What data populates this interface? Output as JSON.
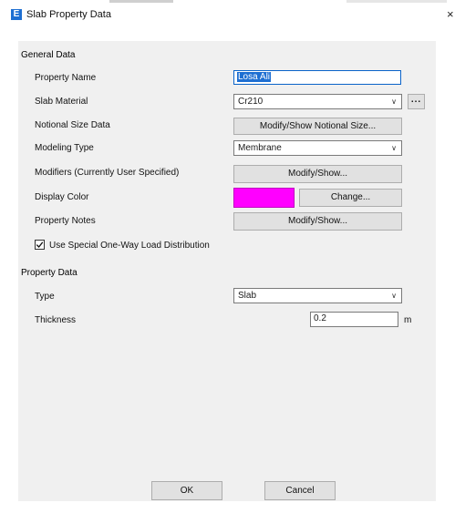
{
  "window": {
    "title": "Slab Property Data",
    "app_icon_letter": "E",
    "close_glyph": "×"
  },
  "general": {
    "heading": "General Data",
    "property_name": {
      "label": "Property Name",
      "value": "Losa Ali"
    },
    "slab_material": {
      "label": "Slab Material",
      "value": "Cr210",
      "more_label": "..."
    },
    "notional_size": {
      "label": "Notional Size Data",
      "button": "Modify/Show Notional Size..."
    },
    "modeling_type": {
      "label": "Modeling Type",
      "value": "Membrane"
    },
    "modifiers": {
      "label": "Modifiers (Currently User Specified)",
      "button": "Modify/Show..."
    },
    "display_color": {
      "label": "Display Color",
      "color": "#ff00ff",
      "button": "Change..."
    },
    "property_notes": {
      "label": "Property Notes",
      "button": "Modify/Show..."
    },
    "one_way": {
      "label": "Use Special One-Way Load Distribution",
      "checked": true
    }
  },
  "property": {
    "heading": "Property Data",
    "type": {
      "label": "Type",
      "value": "Slab"
    },
    "thickness": {
      "label": "Thickness",
      "value": "0.2",
      "unit": "m"
    }
  },
  "footer": {
    "ok": "OK",
    "cancel": "Cancel"
  },
  "icons": {
    "chevron": "chevron-down-icon",
    "check": "check-icon",
    "close": "close-icon",
    "app": "etabs-app-icon"
  }
}
